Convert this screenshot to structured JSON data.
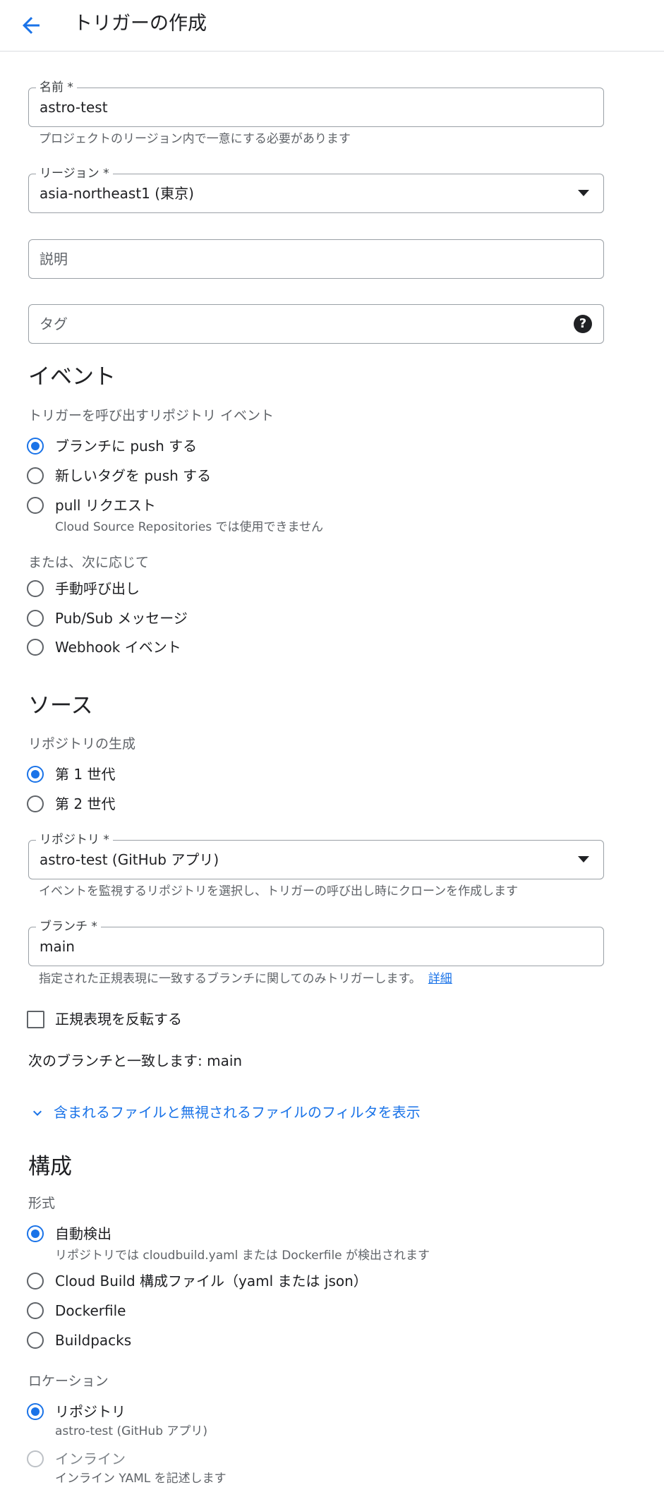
{
  "header": {
    "title": "トリガーの作成"
  },
  "fields": {
    "name": {
      "label": "名前 *",
      "value": "astro-test",
      "hint": "プロジェクトのリージョン内で一意にする必要があります"
    },
    "region": {
      "label": "リージョン *",
      "value": "asia-northeast1 (東京)"
    },
    "description": {
      "placeholder": "説明"
    },
    "tags": {
      "placeholder": "タグ",
      "help_glyph": "?"
    }
  },
  "events": {
    "title": "イベント",
    "subtitle": "トリガーを呼び出すリポジトリ イベント",
    "options": [
      {
        "label": "ブランチに push する",
        "checked": true
      },
      {
        "label": "新しいタグを push する",
        "checked": false
      },
      {
        "label": "pull リクエスト",
        "checked": false,
        "description": "Cloud Source Repositories では使用できません"
      }
    ],
    "or_label": "または、次に応じて",
    "other_options": [
      {
        "label": "手動呼び出し"
      },
      {
        "label": "Pub/Sub メッセージ"
      },
      {
        "label": "Webhook イベント"
      }
    ]
  },
  "source": {
    "title": "ソース",
    "generation_label": "リポジトリの生成",
    "generations": [
      {
        "label": "第 1 世代",
        "checked": true
      },
      {
        "label": "第 2 世代",
        "checked": false
      }
    ],
    "repository": {
      "label": "リポジトリ *",
      "value": "astro-test (GitHub アプリ)",
      "hint": "イベントを監視するリポジトリを選択し、トリガーの呼び出し時にクローンを作成します"
    },
    "branch": {
      "label": "ブランチ *",
      "value": "main",
      "hint": "指定された正規表現に一致するブランチに関してのみトリガーします。",
      "link": "詳細"
    },
    "invert_regex_label": "正規表現を反転する",
    "matches_text": "次のブランチと一致します: main",
    "filter_link": "含まれるファイルと無視されるファイルのフィルタを表示"
  },
  "config": {
    "title": "構成",
    "format_label": "形式",
    "formats": [
      {
        "label": "自動検出",
        "checked": true,
        "description": "リポジトリでは cloudbuild.yaml または Dockerfile が検出されます"
      },
      {
        "label": "Cloud Build 構成ファイル（yaml または json）",
        "checked": false
      },
      {
        "label": "Dockerfile",
        "checked": false
      },
      {
        "label": "Buildpacks",
        "checked": false
      }
    ],
    "location_label": "ロケーション",
    "locations": [
      {
        "label": "リポジトリ",
        "checked": true,
        "description": "astro-test (GitHub アプリ)"
      },
      {
        "label": "インライン",
        "checked": false,
        "disabled": true,
        "description": "インライン YAML を記述します"
      }
    ]
  },
  "colors": {
    "accent": "#1a73e8",
    "text": "#202124",
    "secondary_text": "#5f6368",
    "border": "#9aa0a6"
  }
}
